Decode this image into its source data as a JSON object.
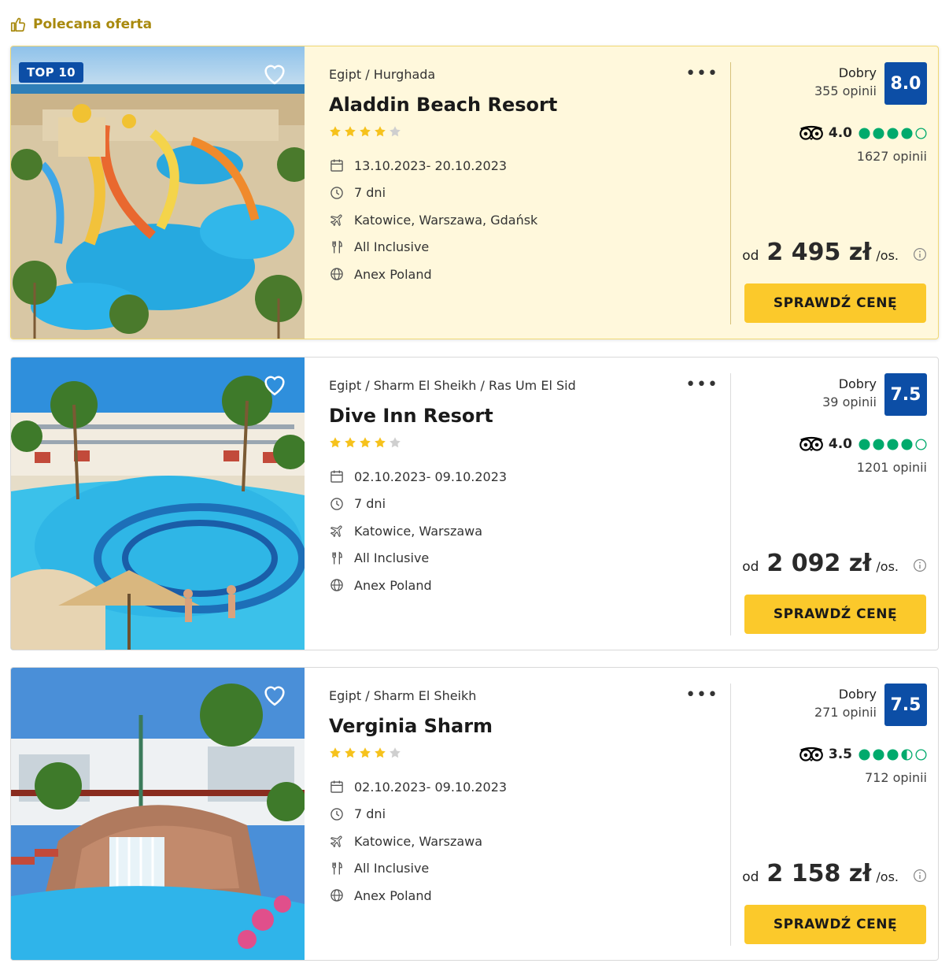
{
  "header": {
    "recommended_label": "Polecana oferta"
  },
  "colors": {
    "accent_yellow": "#fbc92b",
    "rating_blue": "#0c4ea6",
    "tripadvisor_green": "#00aa6c",
    "star_yellow": "#f6c21c",
    "featured_bg": "#fff8dc"
  },
  "offers": [
    {
      "badge": "TOP 10",
      "location": "Egipt / Hurghada",
      "name": "Aladdin Beach Resort",
      "stars": 4,
      "dates": "13.10.2023- 20.10.2023",
      "duration": "7 dni",
      "departure": "Katowice, Warszawa, Gdańsk",
      "board": "All Inclusive",
      "operator": "Anex Poland",
      "rating_label": "Dobry",
      "rating_count": "355 opinii",
      "rating_score": "8.0",
      "ta_score": "4.0",
      "ta_rating": 4.0,
      "ta_count": "1627 opinii",
      "price_prefix": "od",
      "price": "2 495 zł",
      "price_suffix": "/os.",
      "button": "SPRAWDŹ CENĘ",
      "image": "waterpark-resort-photo"
    },
    {
      "badge": "",
      "location": "Egipt / Sharm El Sheikh / Ras Um El Sid",
      "name": "Dive Inn Resort",
      "stars": 4,
      "dates": "02.10.2023- 09.10.2023",
      "duration": "7 dni",
      "departure": "Katowice, Warszawa",
      "board": "All Inclusive",
      "operator": "Anex Poland",
      "rating_label": "Dobry",
      "rating_count": "39 opinii",
      "rating_score": "7.5",
      "ta_score": "4.0",
      "ta_rating": 4.0,
      "ta_count": "1201 opinii",
      "price_prefix": "od",
      "price": "2 092 zł",
      "price_suffix": "/os.",
      "button": "SPRAWDŹ CENĘ",
      "image": "pool-resort-photo"
    },
    {
      "badge": "",
      "location": "Egipt / Sharm El Sheikh",
      "name": "Verginia Sharm",
      "stars": 4,
      "dates": "02.10.2023- 09.10.2023",
      "duration": "7 dni",
      "departure": "Katowice, Warszawa",
      "board": "All Inclusive",
      "operator": "Anex Poland",
      "rating_label": "Dobry",
      "rating_count": "271 opinii",
      "rating_score": "7.5",
      "ta_score": "3.5",
      "ta_rating": 3.5,
      "ta_count": "712 opinii",
      "price_prefix": "od",
      "price": "2 158 zł",
      "price_suffix": "/os.",
      "button": "SPRAWDŹ CENĘ",
      "image": "waterfall-pool-photo"
    }
  ]
}
